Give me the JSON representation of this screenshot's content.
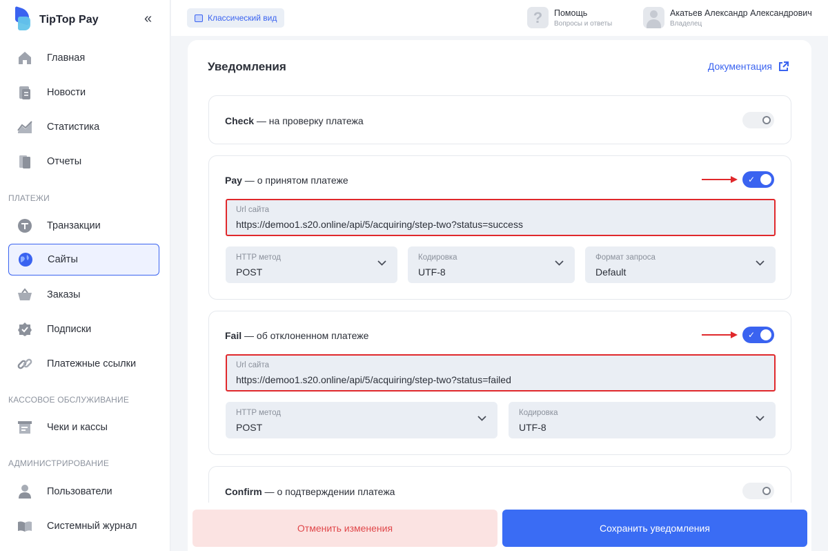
{
  "brand": {
    "name": "TipTop Pay"
  },
  "sidebar": {
    "collapse_label": "«",
    "items_top": [
      {
        "label": "Главная",
        "icon": "home-icon"
      },
      {
        "label": "Новости",
        "icon": "news-icon"
      },
      {
        "label": "Статистика",
        "icon": "chart-icon"
      },
      {
        "label": "Отчеты",
        "icon": "reports-icon"
      }
    ],
    "section_payments": "ПЛАТЕЖИ",
    "items_payments": [
      {
        "label": "Транзакции",
        "icon": "transactions-icon"
      },
      {
        "label": "Сайты",
        "icon": "globe-icon"
      },
      {
        "label": "Заказы",
        "icon": "basket-icon"
      },
      {
        "label": "Подписки",
        "icon": "subscription-icon"
      },
      {
        "label": "Платежные ссылки",
        "icon": "link-icon"
      }
    ],
    "section_cash": "КАССОВОЕ ОБСЛУЖИВАНИЕ",
    "items_cash": [
      {
        "label": "Чеки и кассы",
        "icon": "receipt-icon"
      }
    ],
    "section_admin": "АДМИНИСТРИРОВАНИЕ",
    "items_admin": [
      {
        "label": "Пользователи",
        "icon": "user-icon"
      },
      {
        "label": "Системный журнал",
        "icon": "book-icon"
      }
    ],
    "active_item": "Сайты"
  },
  "topbar": {
    "classic_view": "Классический вид",
    "help_title": "Помощь",
    "help_sub": "Вопросы и ответы",
    "user_name": "Акатьев Александр Александрович",
    "user_role": "Владелец"
  },
  "main": {
    "title": "Уведомления",
    "doc_link": "Документация",
    "check": {
      "name": "Check",
      "desc": " — на проверку платежа",
      "enabled": false
    },
    "pay": {
      "name": "Pay",
      "desc": " — о принятом платеже",
      "enabled": true,
      "url_label": "Url сайта",
      "url_value": "https://demoo1.s20.online/api/5/acquiring/step-two?status=success",
      "method_label": "HTTP метод",
      "method_value": "POST",
      "encoding_label": "Кодировка",
      "encoding_value": "UTF-8",
      "format_label": "Формат запроса",
      "format_value": "Default"
    },
    "fail": {
      "name": "Fail",
      "desc": " — об отклоненном платеже",
      "enabled": true,
      "url_label": "Url сайта",
      "url_value": "https://demoo1.s20.online/api/5/acquiring/step-two?status=failed",
      "method_label": "HTTP метод",
      "method_value": "POST",
      "encoding_label": "Кодировка",
      "encoding_value": "UTF-8"
    },
    "confirm": {
      "name": "Confirm",
      "desc": " — о подтверждении платежа",
      "enabled": false
    }
  },
  "footer": {
    "cancel": "Отменить изменения",
    "save": "Сохранить уведомления"
  },
  "colors": {
    "accent": "#3a63f0",
    "highlight": "#e0282b",
    "cancel_bg": "#fbe3e2"
  }
}
